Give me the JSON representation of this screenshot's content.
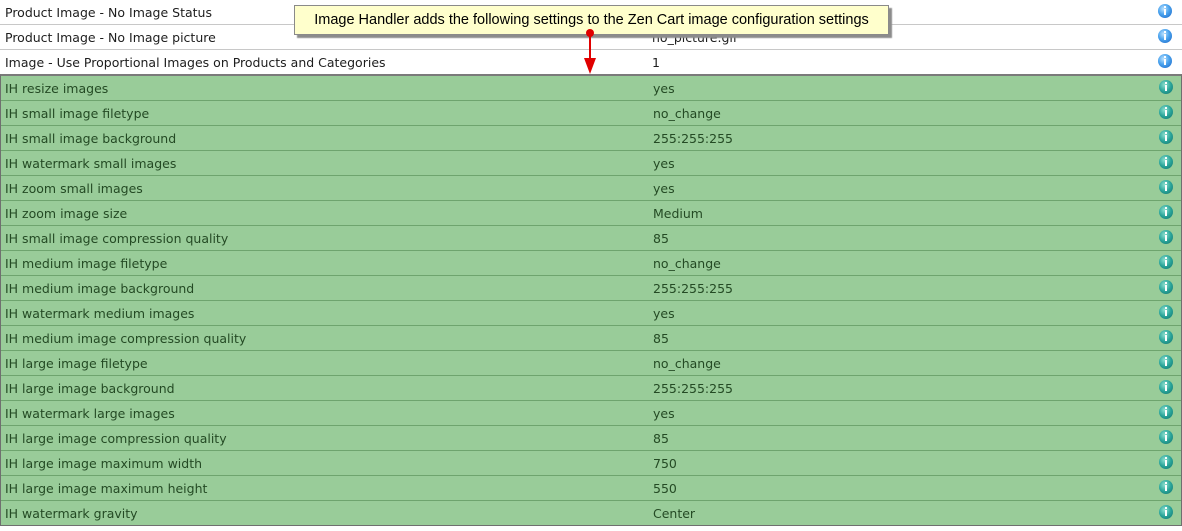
{
  "core_settings": [
    {
      "key": "Product Image - No Image Status",
      "value": ""
    },
    {
      "key": "Product Image - No Image picture",
      "value": "no_picture.gif"
    },
    {
      "key": "Image - Use Proportional Images on Products and Categories",
      "value": "1"
    }
  ],
  "ih_settings": [
    {
      "key": "IH resize images",
      "value": "yes"
    },
    {
      "key": "IH small image filetype",
      "value": "no_change"
    },
    {
      "key": "IH small image background",
      "value": "255:255:255"
    },
    {
      "key": "IH watermark small images",
      "value": "yes"
    },
    {
      "key": "IH zoom small images",
      "value": "yes"
    },
    {
      "key": "IH zoom image size",
      "value": "Medium"
    },
    {
      "key": "IH small image compression quality",
      "value": "85"
    },
    {
      "key": "IH medium image filetype",
      "value": "no_change"
    },
    {
      "key": "IH medium image background",
      "value": "255:255:255"
    },
    {
      "key": "IH watermark medium images",
      "value": "yes"
    },
    {
      "key": "IH medium image compression quality",
      "value": "85"
    },
    {
      "key": "IH large image filetype",
      "value": "no_change"
    },
    {
      "key": "IH large image background",
      "value": "255:255:255"
    },
    {
      "key": "IH watermark large images",
      "value": "yes"
    },
    {
      "key": "IH large image compression quality",
      "value": "85"
    },
    {
      "key": "IH large image maximum width",
      "value": "750"
    },
    {
      "key": "IH large image maximum height",
      "value": "550"
    },
    {
      "key": "IH watermark gravity",
      "value": "Center"
    }
  ],
  "callout": {
    "text": "Image Handler adds the following settings to the Zen Cart image configuration settings"
  },
  "icons": {
    "row_action": "info-icon"
  },
  "colors": {
    "ih_highlight": "#99cc99",
    "callout_bg": "#ffffcc",
    "arrow": "#e00000"
  }
}
